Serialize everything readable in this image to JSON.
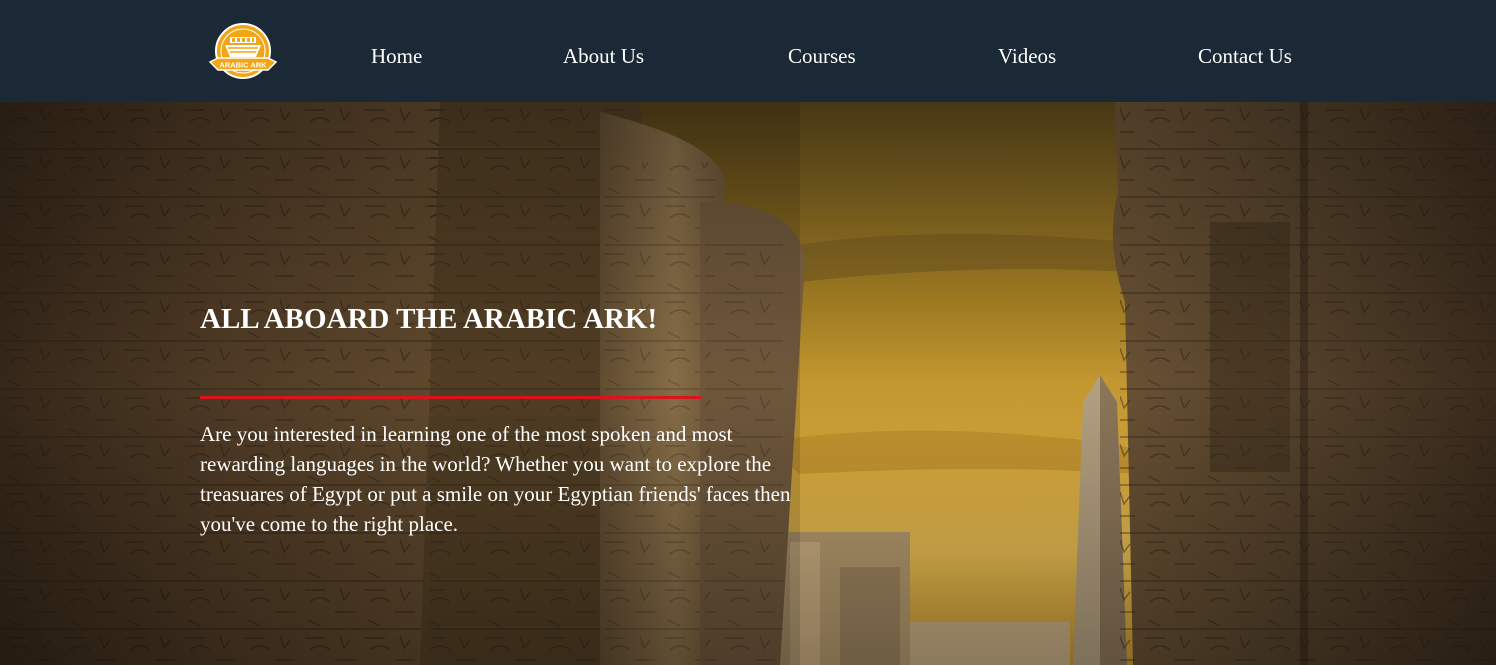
{
  "brand": {
    "logo_text": "ARABIC ARK"
  },
  "nav": {
    "items": [
      {
        "label": "Home"
      },
      {
        "label": "About Us"
      },
      {
        "label": "Courses"
      },
      {
        "label": "Videos"
      },
      {
        "label": "Contact Us"
      }
    ]
  },
  "hero": {
    "title": "ALL ABOARD THE ARABIC ARK!",
    "description": "Are you interested in learning one of the most spoken and most rewarding languages in the world? Whether you want to explore the treasuares of Egypt or put a smile on your Egyptian friends' faces then you've come to the right place.",
    "background_description_icon": "egyptian-temple-columns-obelisk-image"
  },
  "colors": {
    "navbar_bg": "#1b2836",
    "accent_rule": "#d9141c",
    "logo_gold": "#f2a516",
    "text": "#ffffff"
  }
}
